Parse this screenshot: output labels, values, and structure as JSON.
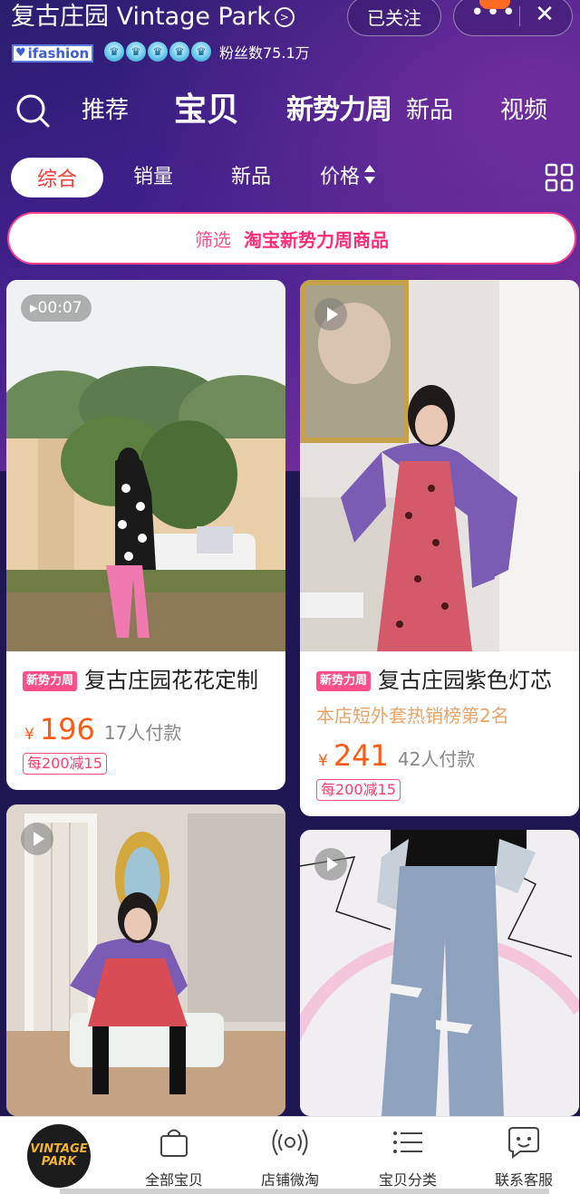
{
  "shop": {
    "name": "复古庄园 Vintage Park",
    "badge": "ifashion",
    "fans": "粉丝数75.1万",
    "follow_label": "已关注",
    "more_label": "•••",
    "close_label": "✕"
  },
  "nav": {
    "tabs": [
      {
        "label": "推荐"
      },
      {
        "label": "宝贝"
      },
      {
        "label": "新势力周"
      },
      {
        "label": "新品"
      },
      {
        "label": "视频"
      }
    ]
  },
  "sort": {
    "items": [
      {
        "label": "综合"
      },
      {
        "label": "销量"
      },
      {
        "label": "新品"
      },
      {
        "label": "价格"
      }
    ]
  },
  "filter": {
    "label": "筛选",
    "value": "淘宝新势力周商品"
  },
  "products": [
    {
      "video_time": "▸00:07",
      "tag": "新势力周",
      "title": "复古庄园花花定制",
      "currency": "¥",
      "price": "196",
      "sold": "17人付款",
      "coupon": "每200减15"
    },
    {
      "tag": "新势力周",
      "title": "复古庄园紫色灯芯",
      "subtitle": "本店短外套热销榜第2名",
      "currency": "¥",
      "price": "241",
      "sold": "42人付款",
      "coupon": "每200减15"
    },
    {},
    {}
  ],
  "bottom_bar": {
    "logo_line1": "VINTAGE",
    "logo_line2": "PARK",
    "items": [
      {
        "label": "全部宝贝",
        "icon": "bag-icon"
      },
      {
        "label": "店铺微淘",
        "icon": "broadcast-icon"
      },
      {
        "label": "宝贝分类",
        "icon": "list-icon"
      },
      {
        "label": "联系客服",
        "icon": "chat-icon"
      }
    ]
  }
}
